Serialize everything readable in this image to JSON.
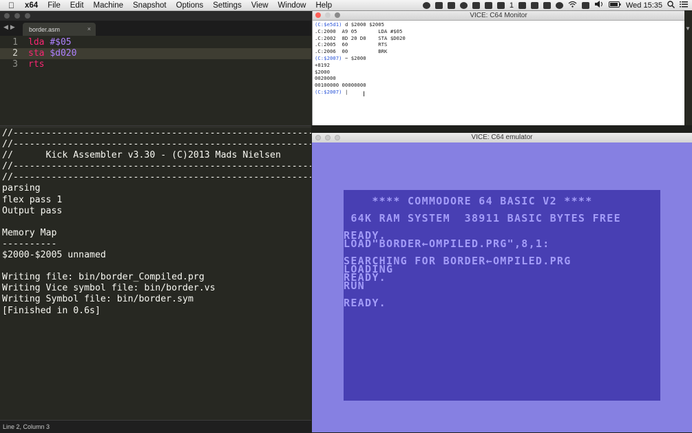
{
  "menubar": {
    "apple": "",
    "app": "x64",
    "items": [
      "File",
      "Edit",
      "Machine",
      "Snapshot",
      "Options",
      "Settings",
      "View",
      "Window",
      "Help"
    ],
    "status_count": "1",
    "clock": "Wed 15:35"
  },
  "editor": {
    "tab_name": "border.asm",
    "tab_close": "×",
    "lines": [
      {
        "num": "1",
        "kw": "lda",
        "arg": "#$05"
      },
      {
        "num": "2",
        "kw": "sta",
        "arg": "$d020"
      },
      {
        "num": "3",
        "kw": "rts",
        "arg": ""
      }
    ],
    "console": [
      "//--------------------------------------------------------",
      "//--------------------------------------------------------",
      "//      Kick Assembler v3.30 - (C)2013 Mads Nielsen",
      "//--------------------------------------------------------",
      "//--------------------------------------------------------",
      "parsing",
      "flex pass 1",
      "Output pass",
      "",
      "Memory Map",
      "----------",
      "$2000-$2005 unnamed",
      "",
      "Writing file: bin/border_Compiled.prg",
      "Writing Vice symbol file: bin/border.vs",
      "Writing Symbol file: bin/border.sym",
      "[Finished in 0.6s]"
    ],
    "status": "Line 2, Column 3"
  },
  "monitor": {
    "title": "VICE: C64 Monitor",
    "lines": [
      {
        "prompt": "(C:$e5d1)",
        "text": " d $2000 $2005"
      },
      {
        "prompt": "",
        "text": ".C:2000  A9 05       LDA #$05"
      },
      {
        "prompt": "",
        "text": ".C:2002  8D 20 D0    STA $D020"
      },
      {
        "prompt": "",
        "text": ".C:2005  60          RTS"
      },
      {
        "prompt": "",
        "text": ".C:2006  00          BRK"
      },
      {
        "prompt": "(C:$2007)",
        "text": " ~ $2000"
      },
      {
        "prompt": "",
        "text": "+8192"
      },
      {
        "prompt": "",
        "text": "$2000"
      },
      {
        "prompt": "",
        "text": "0020000"
      },
      {
        "prompt": "",
        "text": "00100000 00000000"
      },
      {
        "prompt": "(C:$2007)",
        "text": " |"
      }
    ]
  },
  "emulator": {
    "title": "VICE: C64 emulator",
    "screen_lines": [
      "    **** COMMODORE 64 BASIC V2 ****",
      " 64K RAM SYSTEM  38911 BASIC BYTES FREE",
      "READY.",
      "LOAD\"BORDER←OMPILED.PRG\",8,1:",
      "SEARCHING FOR BORDER←OMPILED.PRG",
      "LOADING",
      "READY.",
      "RUN",
      "READY."
    ]
  },
  "colors": {
    "editor_bg": "#272822",
    "keyword": "#f92672",
    "number": "#ae81ff",
    "c64_border": "#8680e2",
    "c64_screen": "#483fb3",
    "c64_text": "#a39cf8",
    "monitor_prompt": "#2a55d8"
  },
  "icons": [
    "apple-icon",
    "wifi-icon",
    "volume-icon",
    "battery-icon",
    "search-icon",
    "list-icon"
  ]
}
